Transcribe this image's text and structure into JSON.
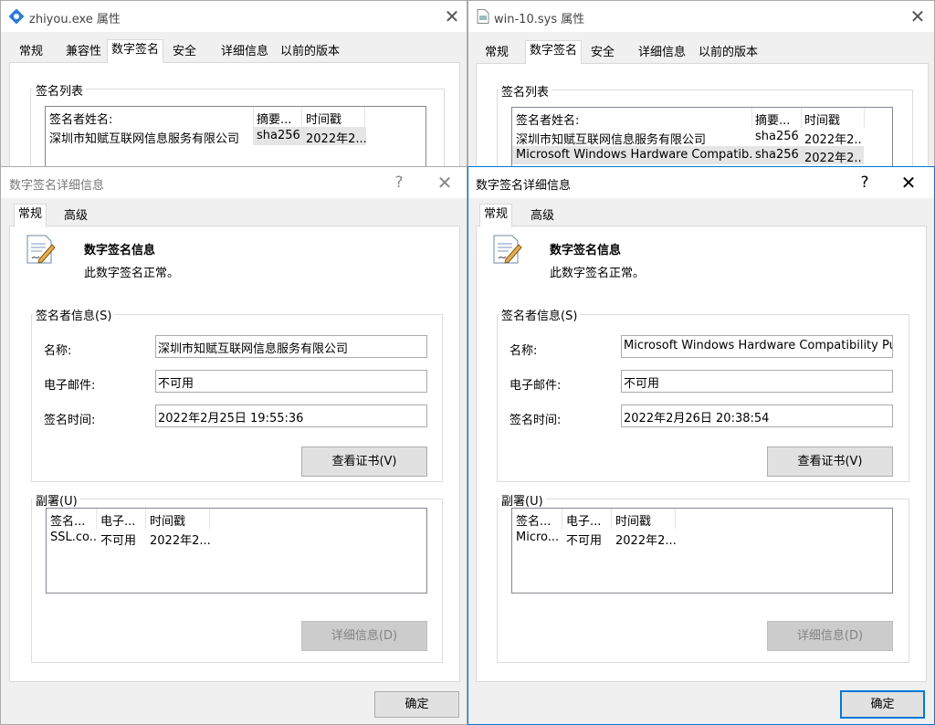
{
  "left_props": {
    "title": "zhiyou.exe 属性",
    "tabs": [
      "常规",
      "兼容性",
      "数字签名",
      "安全",
      "详细信息",
      "以前的版本"
    ],
    "sig_list_label": "签名列表",
    "columns": [
      "签名者姓名:",
      "摘要...",
      "时间戳"
    ],
    "rows": [
      [
        "深圳市知赋互联网信息服务有限公司",
        "sha256",
        "2022年2..."
      ]
    ]
  },
  "right_props": {
    "title": "win-10.sys 属性",
    "tabs": [
      "常规",
      "数字签名",
      "安全",
      "详细信息",
      "以前的版本"
    ],
    "sig_list_label": "签名列表",
    "columns": [
      "签名者姓名:",
      "摘要...",
      "时间戳"
    ],
    "rows": [
      [
        "深圳市知赋互联网信息服务有限公司",
        "sha256",
        "2022年2..."
      ],
      [
        "Microsoft Windows Hardware Compatib...",
        "sha256",
        "2022年2..."
      ]
    ]
  },
  "left_detail": {
    "title": "数字签名详细信息",
    "help": "?",
    "tabs": [
      "常规",
      "高级"
    ],
    "info_heading": "数字签名信息",
    "info_status": "此数字签名正常。",
    "signer_group": "签名者信息(S)",
    "name_label": "名称:",
    "name_value": "深圳市知赋互联网信息服务有限公司",
    "email_label": "电子邮件:",
    "email_value": "不可用",
    "time_label": "签名时间:",
    "time_value": "2022年2月25日 19:55:36",
    "view_cert": "查看证书(V)",
    "counter_group": "副署(U)",
    "counter_columns": [
      "签名...",
      "电子...",
      "时间戳"
    ],
    "counter_rows": [
      [
        "SSL.co...",
        "不可用",
        "2022年2..."
      ]
    ],
    "details_btn": "详细信息(D)",
    "ok_btn": "确定"
  },
  "right_detail": {
    "title": "数字签名详细信息",
    "help": "?",
    "tabs": [
      "常规",
      "高级"
    ],
    "info_heading": "数字签名信息",
    "info_status": "此数字签名正常。",
    "signer_group": "签名者信息(S)",
    "name_label": "名称:",
    "name_value": "Microsoft Windows Hardware Compatibility Publisher",
    "email_label": "电子邮件:",
    "email_value": "不可用",
    "time_label": "签名时间:",
    "time_value": "2022年2月26日 20:38:54",
    "view_cert": "查看证书(V)",
    "counter_group": "副署(U)",
    "counter_columns": [
      "签名...",
      "电子...",
      "时间戳"
    ],
    "counter_rows": [
      [
        "Micro...",
        "不可用",
        "2022年2..."
      ]
    ],
    "details_btn": "详细信息(D)",
    "ok_btn": "确定"
  },
  "colors": {
    "accent": "#0078d7",
    "selection": "#e5e5e5",
    "disabled": "#cccccc"
  },
  "icons": {
    "left_title": "exe-app-icon",
    "right_title": "sys-file-icon",
    "certificate": "signed-certificate-icon"
  }
}
